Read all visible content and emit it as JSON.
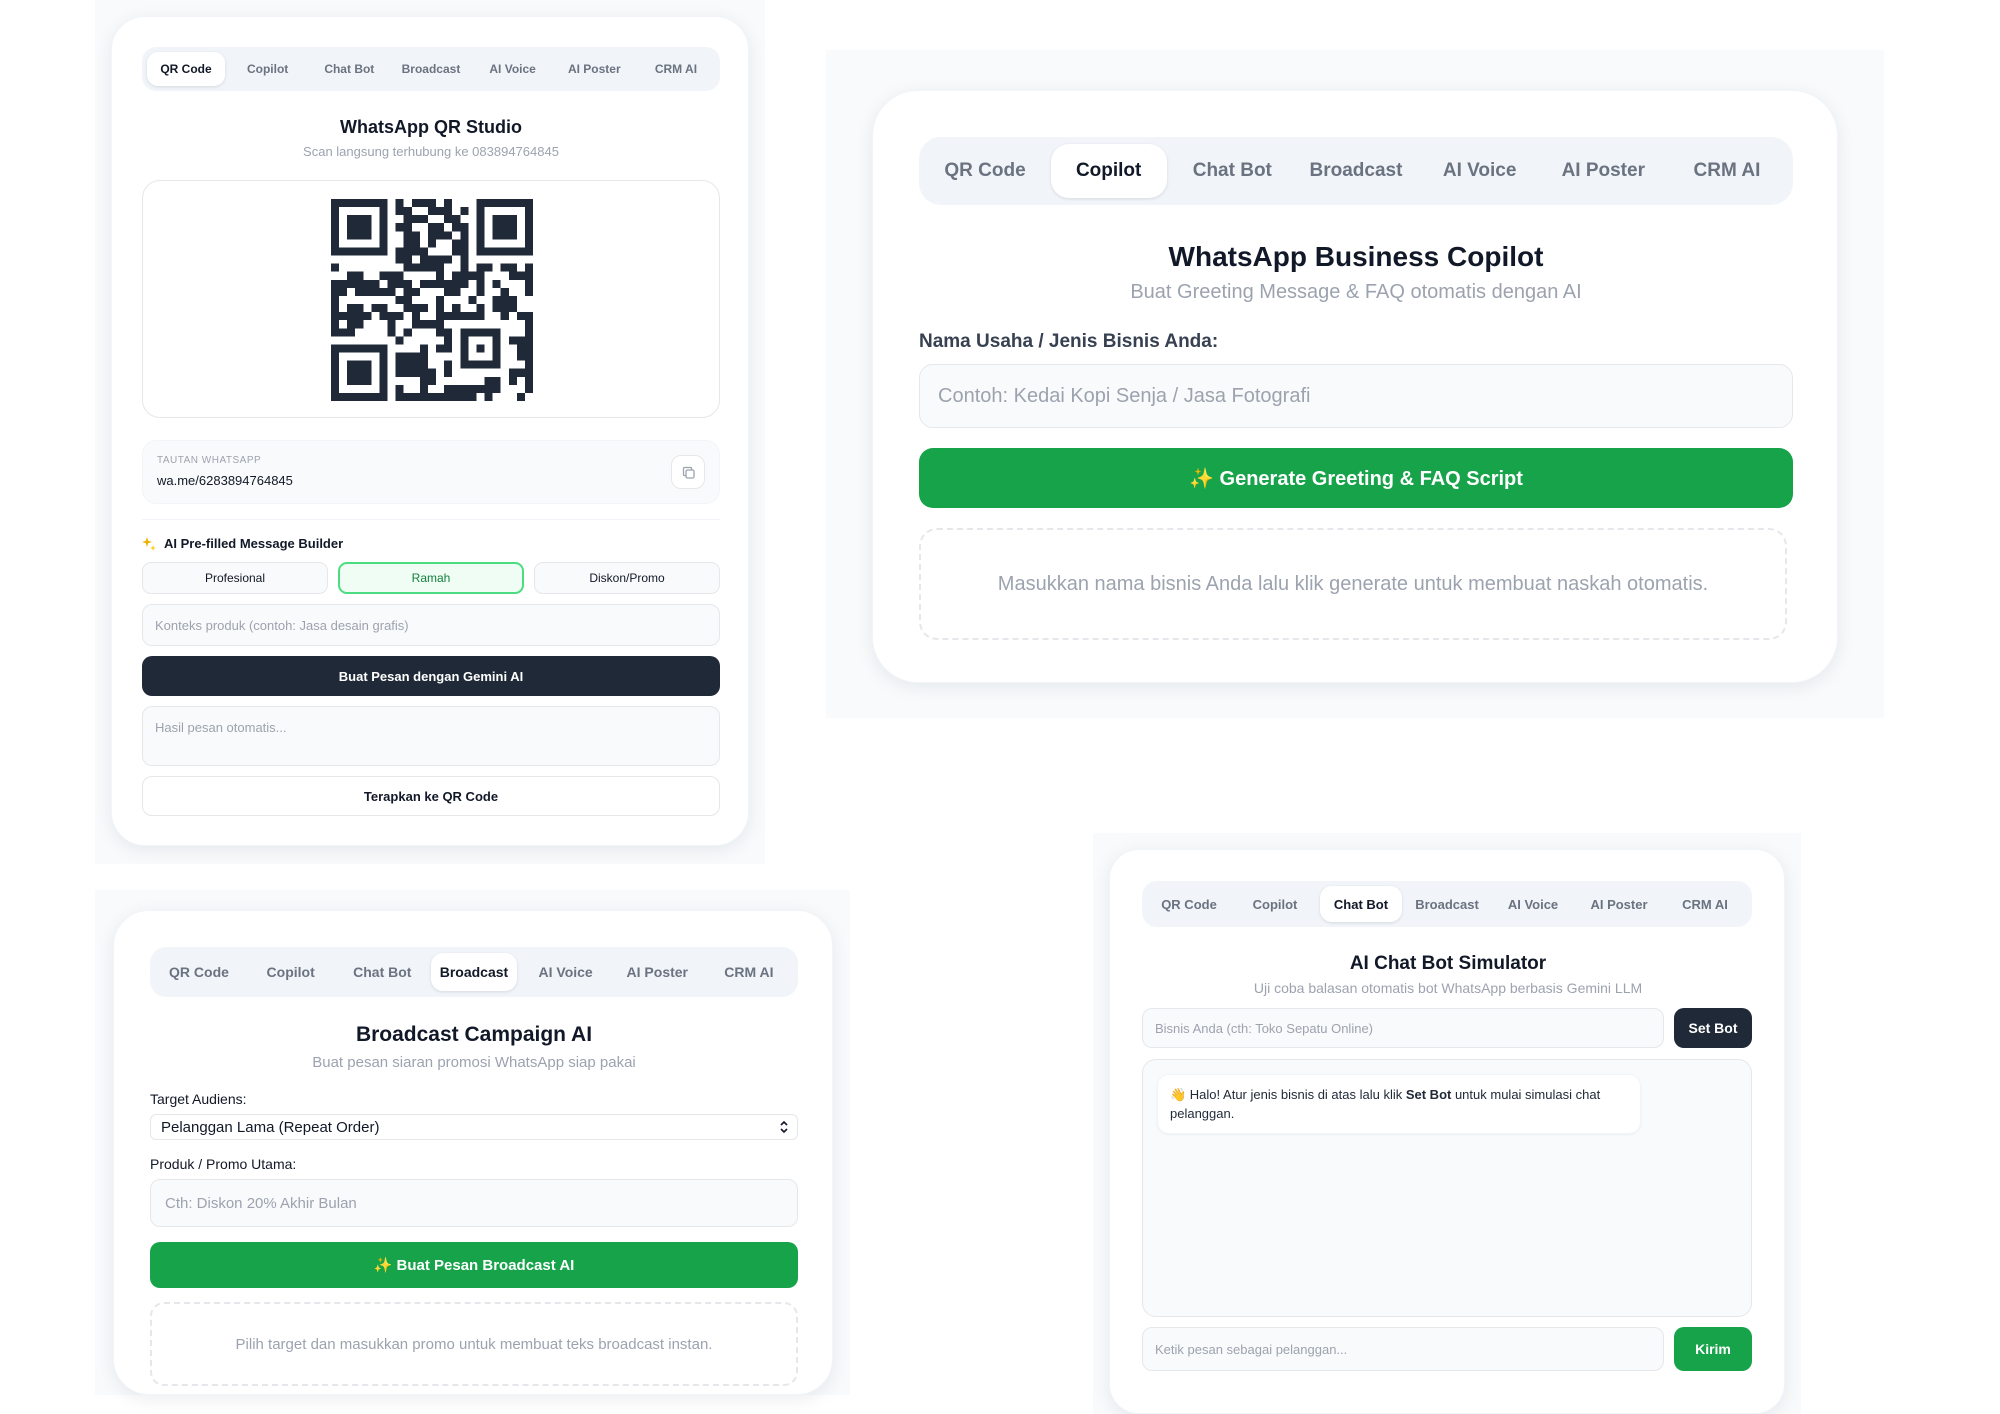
{
  "tabs": [
    "QR Code",
    "Copilot",
    "Chat Bot",
    "Broadcast",
    "AI Voice",
    "AI Poster",
    "CRM AI"
  ],
  "qr": {
    "title": "WhatsApp QR Studio",
    "subtitle": "Scan langsung terhubung ke 083894764845",
    "link_label": "TAUTAN WHATSAPP",
    "link_value": "wa.me/6283894764845",
    "builder_icon": "sparkles",
    "builder_title": "AI Pre-filled Message Builder",
    "tones": [
      "Profesional",
      "Ramah",
      "Diskon/Promo"
    ],
    "selected_tone": "Ramah",
    "context_placeholder": "Konteks produk (contoh: Jasa desain grafis)",
    "generate_label": "Buat Pesan dengan Gemini AI",
    "result_placeholder": "Hasil pesan otomatis...",
    "apply_label": "Terapkan ke QR Code"
  },
  "copilot": {
    "title": "WhatsApp Business Copilot",
    "subtitle": "Buat Greeting Message & FAQ otomatis dengan AI",
    "field_label": "Nama Usaha / Jenis Bisnis Anda:",
    "field_placeholder": "Contoh: Kedai Kopi Senja / Jasa Fotografi",
    "button_label": "✨ Generate Greeting & FAQ Script",
    "empty_text": "Masukkan nama bisnis Anda lalu klik generate untuk membuat naskah otomatis."
  },
  "broadcast": {
    "title": "Broadcast Campaign AI",
    "subtitle": "Buat pesan siaran promosi WhatsApp siap pakai",
    "audience_label": "Target Audiens:",
    "audience_value": "Pelanggan Lama (Repeat Order)",
    "promo_label": "Produk / Promo Utama:",
    "promo_placeholder": "Cth: Diskon 20% Akhir Bulan",
    "button_label": "✨ Buat Pesan Broadcast AI",
    "empty_text": "Pilih target dan masukkan promo untuk membuat teks broadcast instan."
  },
  "chatbot": {
    "title": "AI Chat Bot Simulator",
    "subtitle": "Uji coba balasan otomatis bot WhatsApp berbasis Gemini LLM",
    "business_placeholder": "Bisnis Anda (cth: Toko Sepatu Online)",
    "set_label": "Set Bot",
    "bubble_pre": "👋 Halo! Atur jenis bisnis di atas lalu klik ",
    "bubble_bold": "Set Bot",
    "bubble_post": " untuk mulai simulasi chat pelanggan.",
    "message_placeholder": "Ketik pesan sebagai pelanggan...",
    "send_label": "Kirim"
  },
  "colors": {
    "accent_green": "#16a34a",
    "dark": "#1f2937",
    "muted": "#9ca3af"
  }
}
